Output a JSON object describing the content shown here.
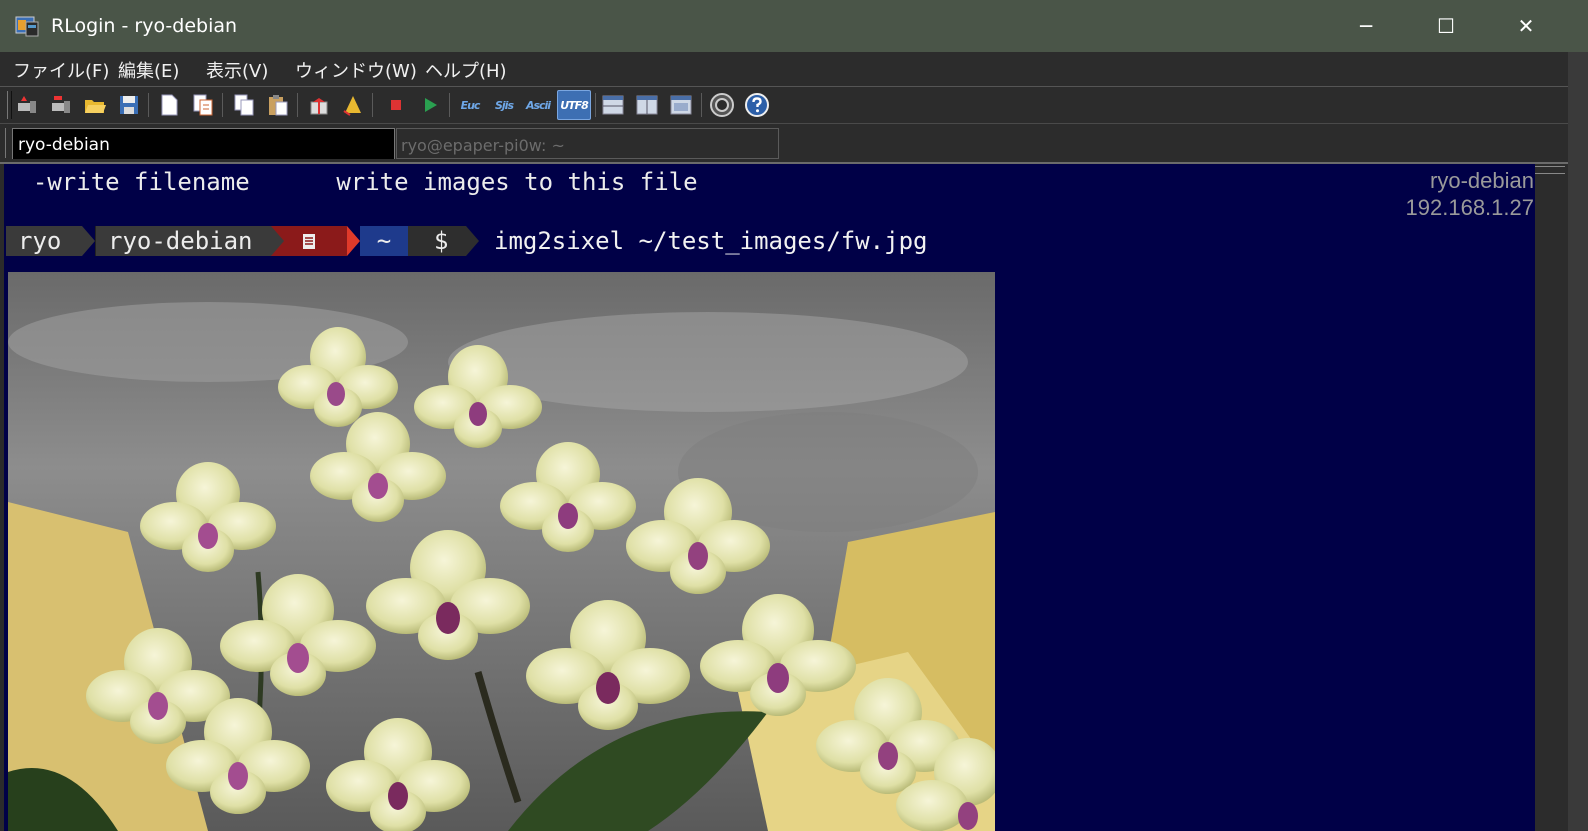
{
  "window": {
    "title": "RLogin - ryo-debian",
    "minimize_glyph": "─",
    "maximize_glyph": "☐",
    "close_glyph": "✕"
  },
  "menu": [
    "ファイル(F)",
    "編集(E)",
    "表示(V)",
    "ウィンドウ(W)",
    "ヘルプ(H)"
  ],
  "toolbar": {
    "euc_label": "Euc",
    "sjis_label": "Sjis",
    "ascii_label": "Ascii",
    "utf8_label": "UTF8",
    "active": "utf8"
  },
  "tabs": [
    {
      "label": "ryo-debian",
      "active": true
    },
    {
      "label": "ryo@epaper-pi0w: ~",
      "active": false
    }
  ],
  "terminal": {
    "line1": "  -write filename      write images to this file",
    "host_name": "ryo-debian",
    "host_ip": "192.168.1.27",
    "prompt": {
      "user": "ryo",
      "host": "ryo-debian",
      "dir": "~",
      "symbol": "$",
      "colors": {
        "user_bg": "#3a3a3a",
        "host_bg": "#3a3a3a",
        "icon_bg": "#8b1a1a",
        "dir_bg": "#1e3a8c",
        "symbol_bg": "#2e2e2e"
      }
    },
    "command": "img2sixel ~/test_images/fw.jpg",
    "background": "#000047"
  }
}
